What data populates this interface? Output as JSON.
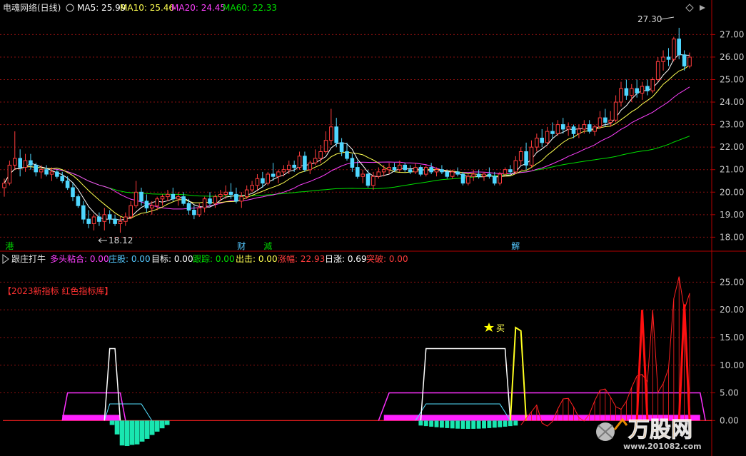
{
  "colors": {
    "up": "#ff3c3c",
    "down": "#4fd7ff",
    "ma5": "#ffffff",
    "ma10": "#ffff50",
    "ma20": "#ff40ff",
    "ma60": "#00e000",
    "grid": "#8a1010",
    "frame": "#b40000"
  },
  "header": {
    "stock": "电魂网络(日线)",
    "ma5": "MA5: 25.99",
    "ma10": "MA10: 25.46",
    "ma20": "MA20: 24.45",
    "ma60": "MA60: 22.33"
  },
  "indicator_header": {
    "name": "跟庄打牛",
    "duotou": "多头粘合: 0.00",
    "zhuanggu": "庄股: 0.00",
    "mubiao": "目标: 0.00",
    "genzong": "跟踪: 0.00",
    "chuji": "出击: 0.00",
    "zhangfu": "涨幅: 22.93",
    "rizhang": "日涨: 0.69",
    "tupo": "突破: 0.00"
  },
  "promo": "【2023新指标 红色指标库】",
  "buy_label": "买",
  "price_max_label": "27.30",
  "price_min_label": "18.12",
  "markers": [
    {
      "label": "港",
      "index": 1
    },
    {
      "label": "财",
      "index": 45
    },
    {
      "label": "減",
      "index": 50
    },
    {
      "label": "解",
      "index": 97
    }
  ],
  "watermark": {
    "logo": "万股网",
    "site": "www.201082.com"
  },
  "chart_data": [
    {
      "type": "candlestick",
      "title": "电魂网络(日线)",
      "ylim": [
        17.6,
        27.9
      ],
      "yticks": [
        18.0,
        19.0,
        20.0,
        21.0,
        22.0,
        23.0,
        24.0,
        25.0,
        26.0,
        27.0
      ],
      "ohlc": [
        [
          20.2,
          20.6,
          19.8,
          20.4
        ],
        [
          20.4,
          21.4,
          20.3,
          21.2
        ],
        [
          21.2,
          22.7,
          21.0,
          21.5
        ],
        [
          21.5,
          21.9,
          20.7,
          21.1
        ],
        [
          21.1,
          21.7,
          20.9,
          21.4
        ],
        [
          21.4,
          21.7,
          21.0,
          21.2
        ],
        [
          21.2,
          21.3,
          20.7,
          20.9
        ],
        [
          20.9,
          21.2,
          20.6,
          21.0
        ],
        [
          21.0,
          21.2,
          20.7,
          20.8
        ],
        [
          20.8,
          21.1,
          20.5,
          20.9
        ],
        [
          20.9,
          21.0,
          20.6,
          20.7
        ],
        [
          20.7,
          20.9,
          20.4,
          20.5
        ],
        [
          20.5,
          20.7,
          20.1,
          20.2
        ],
        [
          20.2,
          20.4,
          19.6,
          19.8
        ],
        [
          19.8,
          19.9,
          19.3,
          19.4
        ],
        [
          19.4,
          19.6,
          18.6,
          18.8
        ],
        [
          18.8,
          19.2,
          18.4,
          18.6
        ],
        [
          18.6,
          19.0,
          18.3,
          18.9
        ],
        [
          18.9,
          19.1,
          18.5,
          18.7
        ],
        [
          18.7,
          19.3,
          18.3,
          19.0
        ],
        [
          19.0,
          19.2,
          18.6,
          18.8
        ],
        [
          18.8,
          19.0,
          18.5,
          18.6
        ],
        [
          18.6,
          18.9,
          18.2,
          18.7
        ],
        [
          18.7,
          19.1,
          18.5,
          18.9
        ],
        [
          18.9,
          19.6,
          18.8,
          19.4
        ],
        [
          19.4,
          20.5,
          19.3,
          20.0
        ],
        [
          20.0,
          20.2,
          19.4,
          19.6
        ],
        [
          19.6,
          19.9,
          19.1,
          19.3
        ],
        [
          19.3,
          19.6,
          19.0,
          19.4
        ],
        [
          19.4,
          19.8,
          19.2,
          19.7
        ],
        [
          19.7,
          19.9,
          19.4,
          19.8
        ],
        [
          19.8,
          20.1,
          19.6,
          19.9
        ],
        [
          19.9,
          20.2,
          19.6,
          19.7
        ],
        [
          19.7,
          20.0,
          19.4,
          19.8
        ],
        [
          19.8,
          20.0,
          19.4,
          19.5
        ],
        [
          19.5,
          19.7,
          19.0,
          19.2
        ],
        [
          19.2,
          19.4,
          18.8,
          19.0
        ],
        [
          19.0,
          19.5,
          18.9,
          19.3
        ],
        [
          19.3,
          19.8,
          19.1,
          19.7
        ],
        [
          19.7,
          20.0,
          19.4,
          19.5
        ],
        [
          19.5,
          19.9,
          19.3,
          19.8
        ],
        [
          19.8,
          20.1,
          19.6,
          19.9
        ],
        [
          19.9,
          20.3,
          19.7,
          20.0
        ],
        [
          20.0,
          20.4,
          19.7,
          19.9
        ],
        [
          19.9,
          20.2,
          19.5,
          19.6
        ],
        [
          19.6,
          20.0,
          19.3,
          19.8
        ],
        [
          19.8,
          20.3,
          19.7,
          20.1
        ],
        [
          20.1,
          20.5,
          20.0,
          20.3
        ],
        [
          20.3,
          20.8,
          20.1,
          20.6
        ],
        [
          20.6,
          20.9,
          20.2,
          20.4
        ],
        [
          20.4,
          20.9,
          20.3,
          20.8
        ],
        [
          20.8,
          21.3,
          20.5,
          20.7
        ],
        [
          20.7,
          21.0,
          20.4,
          20.9
        ],
        [
          20.9,
          21.2,
          20.7,
          21.0
        ],
        [
          21.0,
          21.4,
          20.8,
          21.2
        ],
        [
          21.2,
          21.4,
          20.9,
          21.1
        ],
        [
          21.1,
          21.8,
          21.0,
          21.6
        ],
        [
          21.6,
          21.8,
          20.9,
          21.0
        ],
        [
          21.0,
          21.4,
          20.8,
          21.3
        ],
        [
          21.3,
          21.9,
          21.2,
          21.5
        ],
        [
          21.5,
          22.1,
          21.3,
          21.8
        ],
        [
          21.8,
          22.7,
          21.7,
          22.3
        ],
        [
          22.3,
          23.7,
          22.1,
          22.9
        ],
        [
          22.9,
          23.3,
          22.0,
          22.2
        ],
        [
          22.2,
          22.4,
          21.6,
          21.8
        ],
        [
          21.8,
          22.2,
          21.4,
          21.5
        ],
        [
          21.5,
          21.7,
          20.9,
          21.1
        ],
        [
          21.1,
          21.4,
          20.6,
          20.7
        ],
        [
          20.7,
          21.0,
          20.4,
          20.8
        ],
        [
          20.8,
          21.0,
          20.2,
          20.3
        ],
        [
          20.3,
          20.9,
          20.1,
          20.7
        ],
        [
          20.7,
          21.1,
          20.6,
          20.9
        ],
        [
          20.9,
          21.2,
          20.7,
          21.0
        ],
        [
          21.0,
          21.3,
          20.8,
          21.1
        ],
        [
          21.1,
          21.3,
          20.9,
          21.0
        ],
        [
          21.0,
          21.4,
          20.9,
          21.2
        ],
        [
          21.2,
          21.3,
          20.9,
          21.0
        ],
        [
          21.0,
          21.2,
          20.8,
          20.9
        ],
        [
          20.9,
          21.3,
          20.8,
          21.1
        ],
        [
          21.1,
          21.2,
          20.7,
          20.8
        ],
        [
          20.8,
          21.2,
          20.7,
          21.1
        ],
        [
          21.1,
          21.3,
          20.8,
          20.9
        ],
        [
          20.9,
          21.1,
          20.7,
          21.0
        ],
        [
          21.0,
          21.2,
          20.8,
          20.9
        ],
        [
          20.9,
          21.0,
          20.6,
          20.7
        ],
        [
          20.7,
          21.0,
          20.6,
          20.9
        ],
        [
          20.9,
          21.1,
          20.7,
          20.8
        ],
        [
          20.8,
          20.9,
          20.3,
          20.4
        ],
        [
          20.4,
          20.8,
          20.3,
          20.7
        ],
        [
          20.7,
          21.0,
          20.5,
          20.8
        ],
        [
          20.8,
          21.0,
          20.6,
          20.7
        ],
        [
          20.7,
          20.9,
          20.5,
          20.8
        ],
        [
          20.8,
          21.1,
          20.6,
          20.7
        ],
        [
          20.7,
          20.9,
          20.3,
          20.4
        ],
        [
          20.4,
          20.9,
          20.3,
          20.8
        ],
        [
          20.8,
          21.1,
          20.7,
          21.0
        ],
        [
          21.0,
          21.2,
          20.8,
          20.9
        ],
        [
          20.9,
          21.6,
          20.8,
          21.4
        ],
        [
          21.4,
          22.0,
          21.2,
          21.8
        ],
        [
          21.8,
          22.2,
          21.0,
          21.2
        ],
        [
          21.2,
          22.3,
          21.1,
          22.0
        ],
        [
          22.0,
          22.6,
          21.8,
          22.4
        ],
        [
          22.4,
          22.8,
          22.0,
          22.2
        ],
        [
          22.2,
          22.9,
          22.1,
          22.7
        ],
        [
          22.7,
          23.1,
          22.4,
          22.6
        ],
        [
          22.6,
          23.2,
          22.5,
          23.0
        ],
        [
          23.0,
          23.3,
          22.6,
          22.8
        ],
        [
          22.8,
          23.1,
          22.5,
          22.9
        ],
        [
          22.9,
          23.0,
          22.4,
          22.6
        ],
        [
          22.6,
          23.0,
          22.4,
          22.8
        ],
        [
          22.8,
          23.2,
          22.6,
          23.0
        ],
        [
          23.0,
          23.2,
          22.6,
          22.7
        ],
        [
          22.7,
          23.0,
          22.5,
          22.9
        ],
        [
          22.9,
          23.6,
          22.8,
          23.3
        ],
        [
          23.3,
          23.7,
          22.9,
          23.1
        ],
        [
          23.1,
          23.6,
          22.9,
          23.2
        ],
        [
          23.2,
          24.3,
          23.1,
          24.0
        ],
        [
          24.0,
          24.9,
          23.8,
          24.6
        ],
        [
          24.6,
          25.0,
          24.1,
          24.3
        ],
        [
          24.3,
          24.8,
          24.0,
          24.6
        ],
        [
          24.6,
          25.0,
          24.2,
          24.4
        ],
        [
          24.4,
          24.9,
          24.1,
          24.7
        ],
        [
          24.7,
          25.0,
          24.3,
          24.5
        ],
        [
          24.5,
          25.1,
          24.4,
          25.0
        ],
        [
          25.0,
          26.0,
          24.9,
          25.8
        ],
        [
          25.8,
          26.3,
          25.4,
          26.0
        ],
        [
          26.0,
          26.4,
          25.6,
          25.9
        ],
        [
          25.9,
          26.9,
          25.8,
          26.8
        ],
        [
          26.8,
          27.3,
          25.9,
          26.1
        ],
        [
          26.1,
          26.3,
          25.4,
          25.6
        ],
        [
          25.6,
          26.2,
          25.5,
          26.0
        ]
      ]
    },
    {
      "type": "indicator",
      "ylim": [
        -5.5,
        27.5
      ],
      "yticks": [
        0.0,
        5.0,
        10.0,
        15.0,
        20.0,
        25.0
      ],
      "buy_index": 103
    }
  ]
}
